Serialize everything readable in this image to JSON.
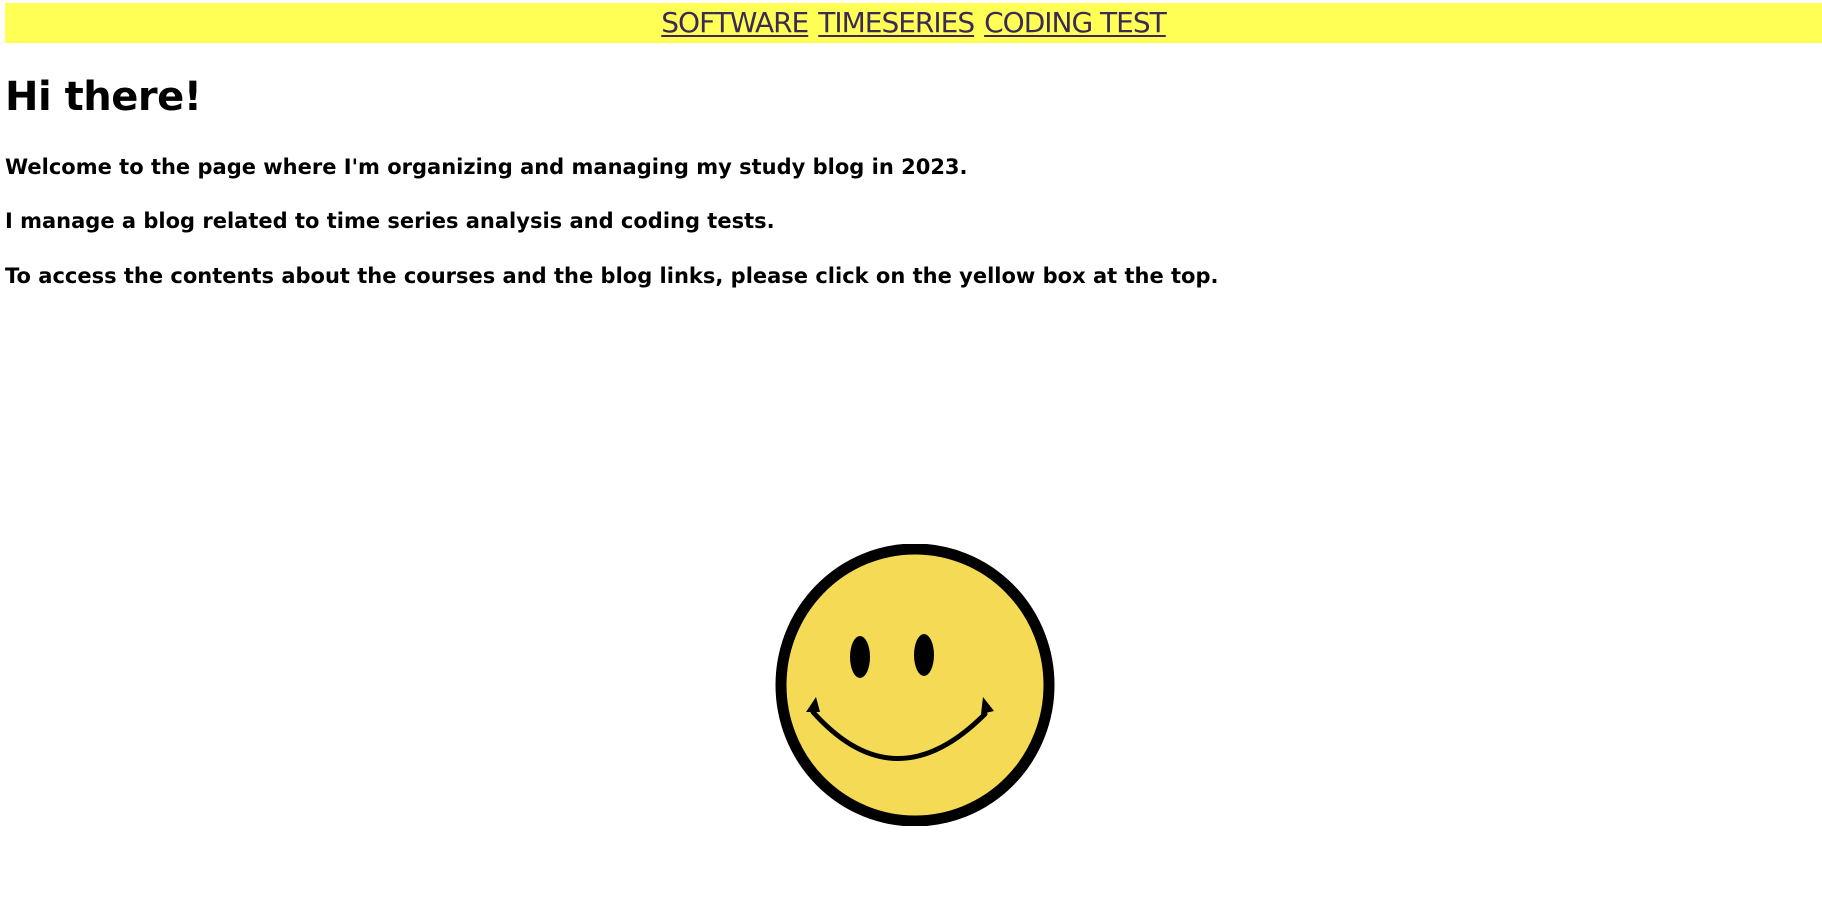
{
  "nav": {
    "background_color": "#ffff55",
    "link_color": "#3a2a55",
    "links": [
      {
        "label": "SOFTWARE"
      },
      {
        "label": "TIMESERIES"
      },
      {
        "label": "CODING TEST"
      }
    ]
  },
  "main": {
    "title": "Hi there!",
    "paragraphs": [
      "Welcome to the page where I'm organizing and managing my study blog in 2023.",
      "I manage a blog related to time series analysis and coding tests.",
      "To access the contents about the courses and the blog links, please click on the yellow box at the top."
    ]
  },
  "image": {
    "icon": "smiley-face-icon",
    "face_color": "#f5db55",
    "outline_color": "#000000"
  }
}
